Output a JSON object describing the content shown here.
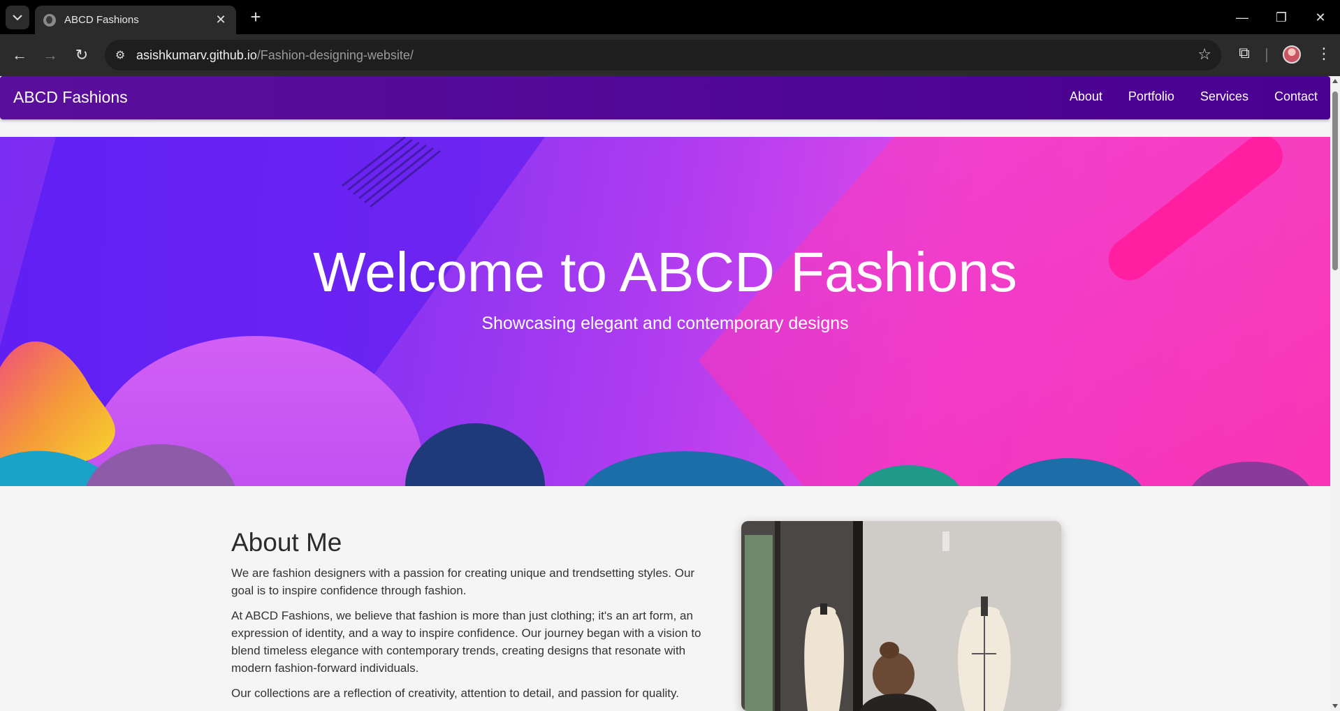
{
  "browser": {
    "tab_title": "ABCD Fashions",
    "url_host": "asishkumarv.github.io",
    "url_path": "/Fashion-designing-website/"
  },
  "site": {
    "brand": "ABCD Fashions",
    "nav": [
      "About",
      "Portfolio",
      "Services",
      "Contact"
    ]
  },
  "hero": {
    "title": "Welcome to ABCD Fashions",
    "subtitle": "Showcasing elegant and contemporary designs"
  },
  "about": {
    "heading": "About Me",
    "paragraphs": [
      "We are fashion designers with a passion for creating unique and trendsetting styles. Our goal is to inspire confidence through fashion.",
      "At ABCD Fashions, we believe that fashion is more than just clothing; it's an art form, an expression of identity, and a way to inspire confidence. Our journey began with a vision to blend timeless elegance with contemporary trends, creating designs that resonate with modern fashion-forward individuals.",
      "Our collections are a reflection of creativity, attention to detail, and passion for quality."
    ]
  },
  "colors": {
    "nav_bg": "#4a0090",
    "hero_start": "#7a2cf0",
    "hero_end": "#f050d0",
    "page_bg": "#f5f5f5"
  }
}
